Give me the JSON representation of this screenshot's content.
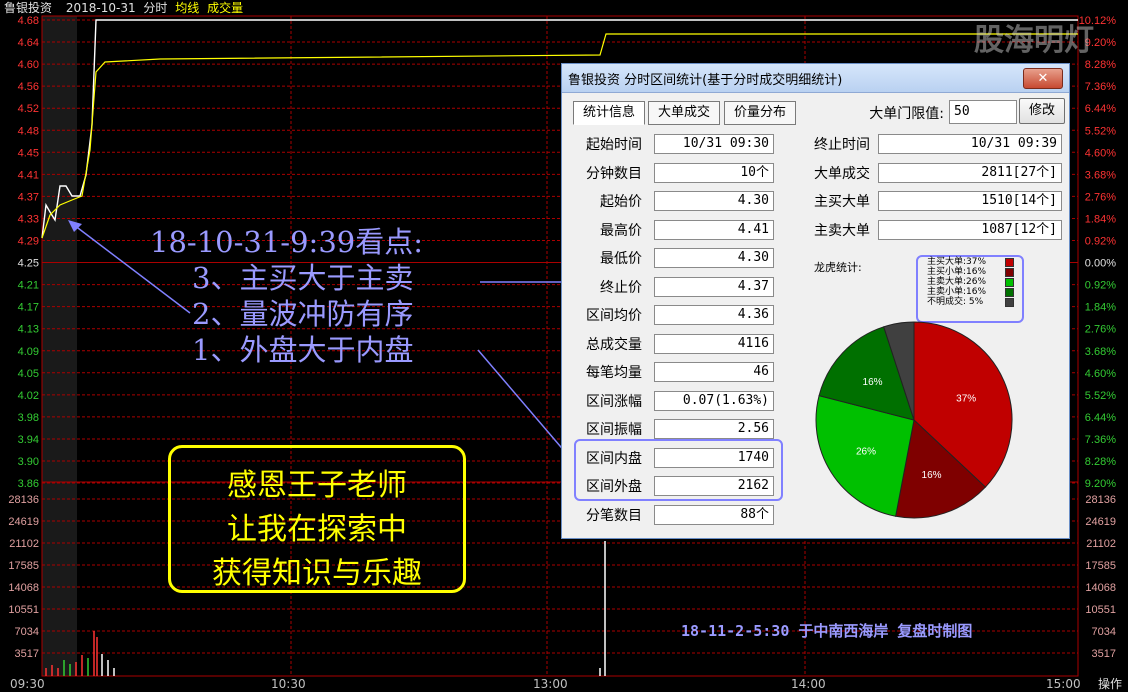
{
  "header": {
    "stock": "鲁银投资",
    "date": "2018-10-31",
    "mode": "分时",
    "avg_label": "均线",
    "vol_label": "成交量"
  },
  "left_axis": [
    "4.68",
    "4.64",
    "4.60",
    "4.56",
    "4.52",
    "4.48",
    "4.45",
    "4.41",
    "4.37",
    "4.33",
    "4.29",
    "4.25",
    "4.21",
    "4.17",
    "4.13",
    "4.09",
    "4.05",
    "4.02",
    "3.98",
    "3.94",
    "3.90",
    "3.86"
  ],
  "right_axis": [
    "10.12%",
    "9.20%",
    "8.28%",
    "7.36%",
    "6.44%",
    "5.52%",
    "4.60%",
    "3.68%",
    "2.76%",
    "1.84%",
    "0.92%",
    "0.00%",
    "0.92%",
    "1.84%",
    "2.76%",
    "3.68%",
    "4.60%",
    "5.52%",
    "6.44%",
    "7.36%",
    "8.28%",
    "9.20%"
  ],
  "vol_axis": [
    "28136",
    "24619",
    "21102",
    "17585",
    "14068",
    "10551",
    "7034",
    "3517"
  ],
  "time_axis": [
    "09:30",
    "10:30",
    "13:00",
    "14:00",
    "15:00"
  ],
  "operate_label": "操作",
  "watermark": "股海明灯",
  "dialog": {
    "title": "鲁银投资 分时区间统计(基于分时成交明细统计)",
    "close": "✕",
    "tabs": [
      "统计信息",
      "大单成交",
      "价量分布"
    ],
    "threshold_label": "大单门限值:",
    "threshold_value": "50",
    "modify": "修改",
    "left_rows": [
      {
        "label": "起始时间",
        "value": "10/31 09:30"
      },
      {
        "label": "分钟数目",
        "value": "10个"
      },
      {
        "label": "起始价",
        "value": "4.30"
      },
      {
        "label": "最高价",
        "value": "4.41"
      },
      {
        "label": "最低价",
        "value": "4.30"
      },
      {
        "label": "终止价",
        "value": "4.37"
      },
      {
        "label": "区间均价",
        "value": "4.36"
      },
      {
        "label": "总成交量",
        "value": "4116"
      },
      {
        "label": "每笔均量",
        "value": "46"
      },
      {
        "label": "区间涨幅",
        "value": "0.07(1.63%)"
      },
      {
        "label": "区间振幅",
        "value": "2.56"
      },
      {
        "label": "区间内盘",
        "value": "1740"
      },
      {
        "label": "区间外盘",
        "value": "2162"
      },
      {
        "label": "分笔数目",
        "value": "88个"
      }
    ],
    "right_rows": [
      {
        "label": "终止时间",
        "value": "10/31 09:39"
      },
      {
        "label": "大单成交",
        "value": "2811[27个]"
      },
      {
        "label": "主买大单",
        "value": "1510[14个]"
      },
      {
        "label": "主卖大单",
        "value": "1087[12个]"
      }
    ],
    "dragon_label": "龙虎统计:",
    "legend": [
      "主买大单:37%",
      "主买小单:16%",
      "主卖大单:26%",
      "主卖小单:16%",
      "不明成交: 5%"
    ]
  },
  "chart_data": {
    "type": "pie",
    "categories": [
      "主买大单",
      "主买小单",
      "主卖大单",
      "主卖小单",
      "不明成交"
    ],
    "values": [
      37,
      16,
      26,
      16,
      5
    ],
    "labels": [
      "37%",
      "16%",
      "26%",
      "16%",
      ""
    ],
    "colors": [
      "#c00000",
      "#7f0000",
      "#00c000",
      "#007000",
      "#404040"
    ]
  },
  "annotation": {
    "title": "18-10-31-9:39看点:",
    "lines": [
      "3、主买大于主卖",
      "2、量波冲防有序",
      "1、外盘大于内盘"
    ]
  },
  "thanks": [
    "感恩王子老师",
    "让我在探索中",
    "获得知识与乐趣"
  ],
  "credit": "18-11-2-5:30 于中南西海岸 复盘时制图",
  "colors": {
    "grid": "#aa0000",
    "price": "#ffffff",
    "avg": "#ffff00",
    "up": "#ff3333",
    "down": "#33cc33",
    "dialog_border": "#8080ff"
  }
}
